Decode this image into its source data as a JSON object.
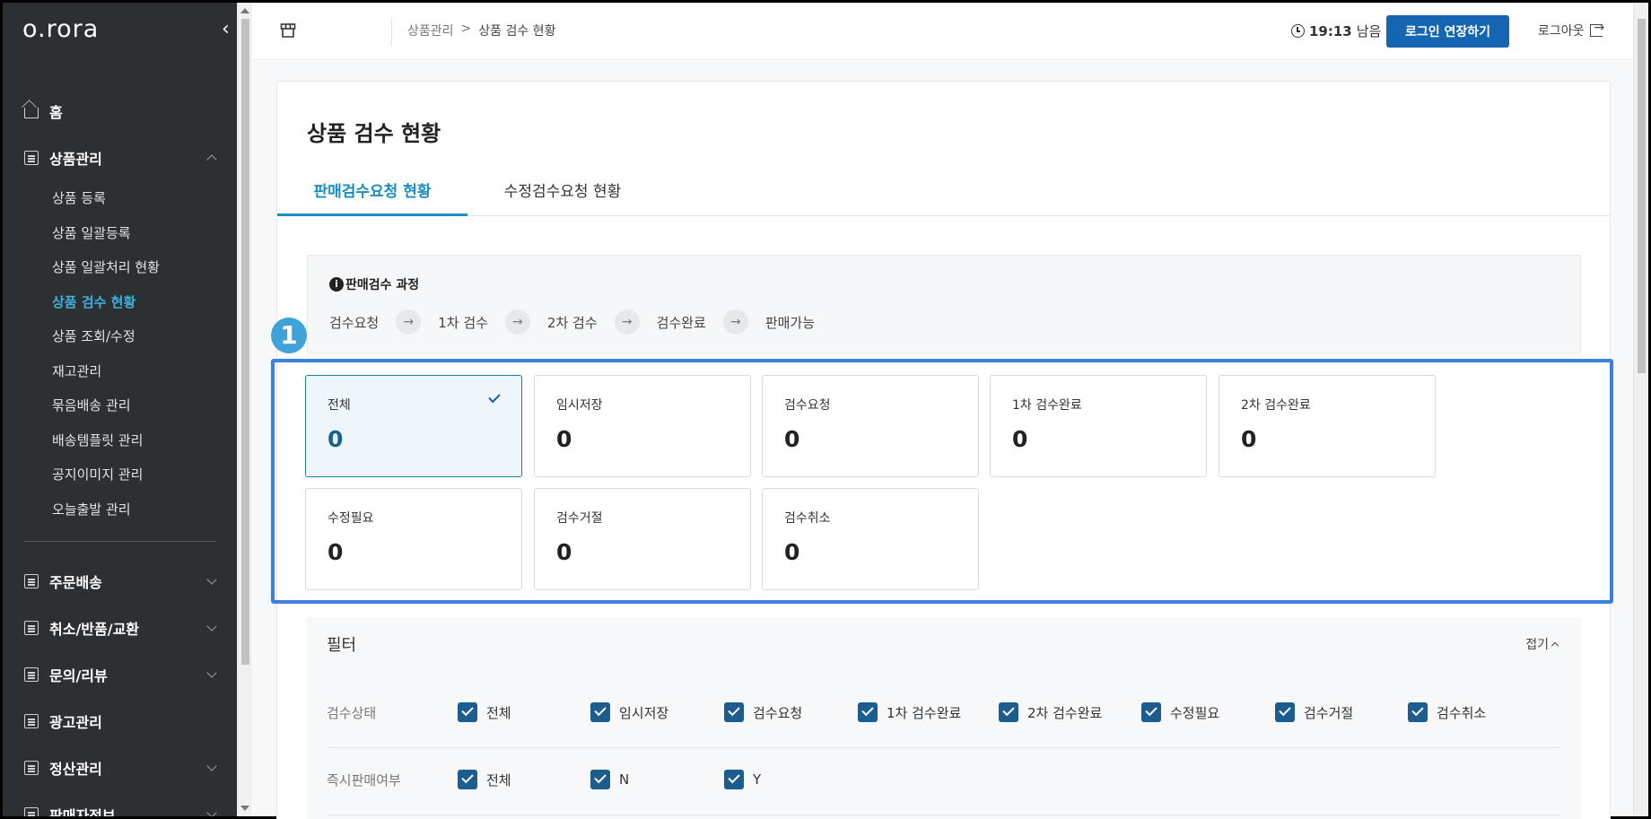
{
  "sidebar": {
    "logo": "o.rora",
    "collapse_icon": "chevron-left-icon",
    "home": "홈",
    "product_mgmt": "상품관리",
    "product_items": [
      "상품 등록",
      "상품 일괄등록",
      "상품 일괄처리 현황",
      "상품 검수 현황",
      "상품 조회/수정",
      "재고관리",
      "묶음배송 관리",
      "배송템플릿 관리",
      "공지이미지 관리",
      "오늘출발 관리"
    ],
    "active_item": "상품 검수 현황",
    "other_menus": [
      "주문배송",
      "취소/반품/교환",
      "문의/리뷰",
      "광고관리",
      "정산관리",
      "판매자정보"
    ]
  },
  "header": {
    "breadcrumb_parent": "상품관리",
    "breadcrumb_sep": ">",
    "breadcrumb_current": "상품 검수 현황",
    "timer": "19:13",
    "timer_suffix": "남음",
    "extend_button": "로그인 연장하기",
    "logout": "로그아웃"
  },
  "page": {
    "title": "상품 검수 현황",
    "tabs": [
      "판매검수요청 현황",
      "수정검수요청 현황"
    ],
    "active_tab": "판매검수요청 현황",
    "process_title": "판매검수 과정",
    "process_steps": [
      "검수요청",
      "1차 검수",
      "2차 검수",
      "검수완료",
      "판매가능"
    ],
    "annotation_number": "1"
  },
  "stats": [
    {
      "label": "전체",
      "value": "0",
      "selected": true
    },
    {
      "label": "임시저장",
      "value": "0"
    },
    {
      "label": "검수요청",
      "value": "0"
    },
    {
      "label": "1차 검수완료",
      "value": "0"
    },
    {
      "label": "2차 검수완료",
      "value": "0"
    },
    {
      "label": "수정필요",
      "value": "0"
    },
    {
      "label": "검수거절",
      "value": "0"
    },
    {
      "label": "검수취소",
      "value": "0"
    }
  ],
  "filter": {
    "title": "필터",
    "fold_label": "접기",
    "status_label": "검수상태",
    "status_options": [
      "전체",
      "임시저장",
      "검수요청",
      "1차 검수완료",
      "2차 검수완료",
      "수정필요",
      "검수거절",
      "검수취소"
    ],
    "instant_label": "즉시판매여부",
    "instant_options": [
      "전체",
      "N",
      "Y"
    ]
  },
  "colors": {
    "sidebar_bg": "#2d3033",
    "active_menu": "#3fb1dc",
    "primary": "#1466b3",
    "checkbox": "#1c5c8f",
    "highlight_border": "#3d7fe0"
  }
}
